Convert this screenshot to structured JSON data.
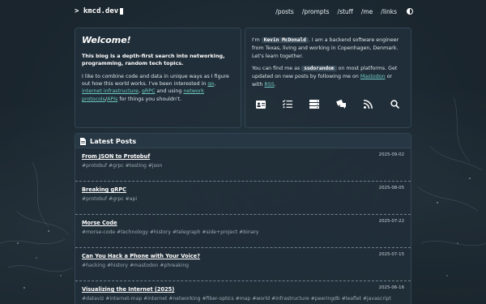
{
  "header": {
    "logo": "> kmcd.dev",
    "nav": [
      "/posts",
      "/prompts",
      "/stuff",
      "/me",
      "/links"
    ]
  },
  "welcome": {
    "title": "Welcome!",
    "lead": "This blog is a depth-first search into networking, programming, random tech topics.",
    "body_1": "I like to combine code and data in unique ways as I figure out how this world works. I've been interested in ",
    "link_go": "go",
    "sep_1": ", ",
    "link_infra": "internet infrastructure",
    "sep_2": ", ",
    "link_grpc": "gRPC",
    "body_2": " and using ",
    "link_protocols": "network protocols",
    "sep_3": "/",
    "link_apis": "APIs",
    "body_3": " for things you shouldn't."
  },
  "about": {
    "p1_a": "I'm ",
    "name": "Kevin McDonald",
    "p1_b": ". I am a backend software engineer from Texas, living and working in Copenhagen, Denmark. Let's learn together.",
    "p2_a": "You can find me as ",
    "handle": "sudorandom",
    "p2_b": " on most platforms. Get updated on new posts by following me on ",
    "link_mastodon": "Mastodon",
    "p2_c": " or with ",
    "link_rss": "RSS",
    "p2_d": ".",
    "icons": [
      "id-card-icon",
      "tasks-icon",
      "server-icon",
      "chat-icon",
      "rss-icon",
      "search-icon"
    ]
  },
  "posts": {
    "heading": "Latest Posts",
    "items": [
      {
        "title": "From JSON to Protobuf",
        "date": "2025-09-02",
        "tags": "#protobuf #grpc #testing #json"
      },
      {
        "title": "Breaking gRPC",
        "date": "2025-08-05",
        "tags": "#protobuf #grpc #api"
      },
      {
        "title": "Morse Code",
        "date": "2025-07-22",
        "tags": "#morse-code #technology #history #telegraph #side+project #binary"
      },
      {
        "title": "Can You Hack a Phone with Your Voice?",
        "date": "2025-07-15",
        "tags": "#hacking #history #mastodon #phreaking"
      },
      {
        "title": "Visualizing the Internet (2025)",
        "date": "2025-06-16",
        "tags": "#dataviz #internet-map #internet #networking #fiber-optics #map #world #infrastructure #peeringdb #leaflet #javascript"
      }
    ]
  },
  "colors": {
    "background": "#1b2730",
    "card": "#212f39",
    "link": "#6fc9c1"
  }
}
